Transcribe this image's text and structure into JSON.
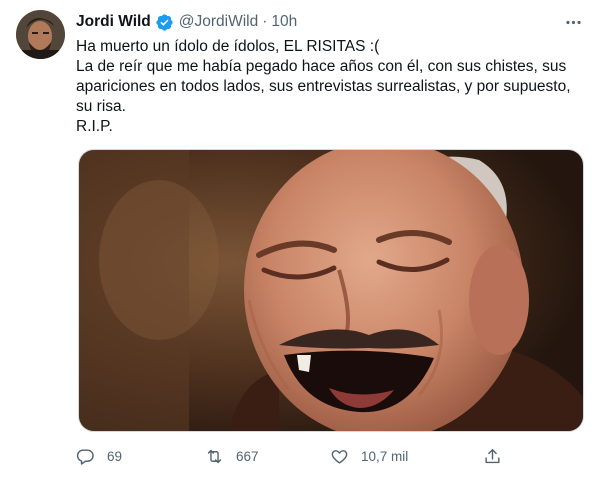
{
  "tweet": {
    "author_name": "Jordi Wild",
    "handle": "@JordiWild",
    "separator": "·",
    "time": "10h",
    "lines": [
      "Ha muerto un ídolo de ídolos, EL RISITAS :(",
      "La de reír que me había pegado hace años con él, con sus chistes, sus",
      "apariciones en todos lados, sus entrevistas surrealistas, y por supuesto,",
      "su risa.",
      "R.I.P."
    ]
  },
  "actions": {
    "reply_count": "69",
    "retweet_count": "667",
    "like_count": "10,7 mil"
  },
  "icons": {
    "verified": "verified-badge-icon",
    "more": "more-horizontal-icon",
    "reply": "reply-icon",
    "retweet": "retweet-icon",
    "like": "heart-icon",
    "share": "share-icon"
  },
  "colors": {
    "text": "#0f1419",
    "secondary": "#536471",
    "verified": "#1d9bf0",
    "border": "#cfd9de"
  }
}
